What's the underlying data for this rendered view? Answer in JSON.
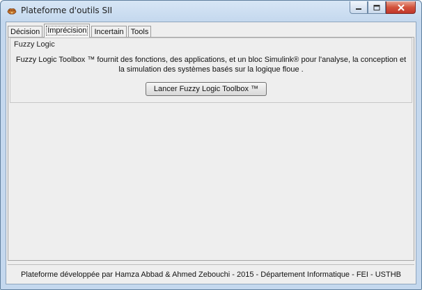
{
  "window": {
    "title": "Plateforme d'outils SII",
    "icon": "app-logo-icon"
  },
  "caption_buttons": [
    "minimize-icon",
    "maximize-icon",
    "close-icon"
  ],
  "tabs": [
    {
      "label": "Décision"
    },
    {
      "label": "Imprécision",
      "selected": true
    },
    {
      "label": "Incertain"
    },
    {
      "label": "Tools"
    }
  ],
  "panel": {
    "group_title": "Fuzzy Logic",
    "description_line1": "Fuzzy Logic Toolbox ™ fournit des fonctions, des applications, et un bloc Simulink® pour l'analyse, la conception et",
    "description_line2": "la simulation des systèmes basés sur la logique floue .",
    "button_label": "Lancer Fuzzy Logic Toolbox ™"
  },
  "footer": {
    "text": "Plateforme développée par Hamza Abbad & Ahmed Zebouchi - 2015 - Département Informatique - FEI - USTHB"
  },
  "colors": {
    "frame": "#c4d8ee",
    "client_bg": "#eeeeee",
    "close_button": "#c0362a"
  }
}
